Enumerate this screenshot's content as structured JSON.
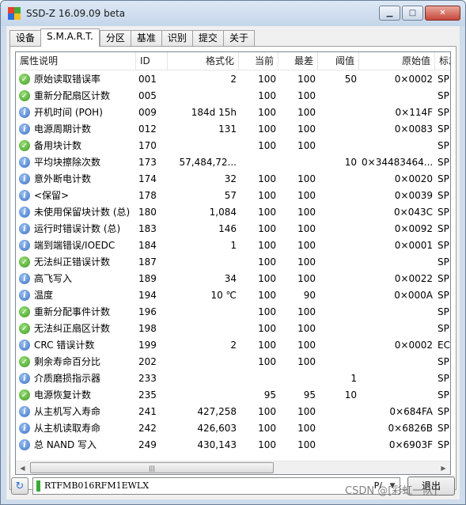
{
  "window": {
    "title": "SSD-Z 16.09.09 beta"
  },
  "tabs": [
    "设备",
    "S.M.A.R.T.",
    "分区",
    "基准",
    "识别",
    "提交",
    "关于"
  ],
  "active_tab": 1,
  "columns": [
    "属性说明",
    "ID",
    "格式化",
    "当前",
    "最差",
    "阈值",
    "原始值",
    "标志"
  ],
  "rows": [
    {
      "icon": "ok-icon",
      "name": "原始读取错误率",
      "id": "001",
      "formatted": "2",
      "current": "100",
      "worst": "100",
      "threshold": "50",
      "raw": "0×0002",
      "flags": "SP ER P"
    },
    {
      "icon": "ok-icon",
      "name": "重新分配扇区计数",
      "id": "005",
      "formatted": "",
      "current": "100",
      "worst": "100",
      "threshold": "",
      "raw": "",
      "flags": "SP EC C"
    },
    {
      "icon": "info-icon",
      "name": "开机时间 (POH)",
      "id": "009",
      "formatted": "184d 15h",
      "current": "100",
      "worst": "100",
      "threshold": "",
      "raw": "0×114F",
      "flags": "SP EC C"
    },
    {
      "icon": "info-icon",
      "name": "电源周期计数",
      "id": "012",
      "formatted": "131",
      "current": "100",
      "worst": "100",
      "threshold": "",
      "raw": "0×0083",
      "flags": "SP EC C"
    },
    {
      "icon": "ok-icon",
      "name": "备用块计数",
      "id": "170",
      "formatted": "",
      "current": "100",
      "worst": "100",
      "threshold": "",
      "raw": "",
      "flags": "SP EC C"
    },
    {
      "icon": "info-icon",
      "name": "平均块擦除次数",
      "id": "173",
      "formatted": "57,484,72...",
      "current": "",
      "worst": "",
      "threshold": "10",
      "raw": "0×34483464...",
      "flags": "SP EC C"
    },
    {
      "icon": "info-icon",
      "name": "意外断电计数",
      "id": "174",
      "formatted": "32",
      "current": "100",
      "worst": "100",
      "threshold": "",
      "raw": "0×0020",
      "flags": "SP EC C"
    },
    {
      "icon": "info-icon",
      "name": "<保留>",
      "id": "178",
      "formatted": "57",
      "current": "100",
      "worst": "100",
      "threshold": "",
      "raw": "0×0039",
      "flags": "SP EC C"
    },
    {
      "icon": "info-icon",
      "name": "未使用保留块计数 (总)",
      "id": "180",
      "formatted": "1,084",
      "current": "100",
      "worst": "100",
      "threshold": "",
      "raw": "0×043C",
      "flags": "SP EC C"
    },
    {
      "icon": "info-icon",
      "name": "运行时错误计数 (总)",
      "id": "183",
      "formatted": "146",
      "current": "100",
      "worst": "100",
      "threshold": "",
      "raw": "0×0092",
      "flags": "SP EC C"
    },
    {
      "icon": "info-icon",
      "name": "端到端错误/IOEDC",
      "id": "184",
      "formatted": "1",
      "current": "100",
      "worst": "100",
      "threshold": "",
      "raw": "0×0001",
      "flags": "SP EC C"
    },
    {
      "icon": "ok-icon",
      "name": "无法纠正错误计数",
      "id": "187",
      "formatted": "",
      "current": "100",
      "worst": "100",
      "threshold": "",
      "raw": "",
      "flags": "SP EC E"
    },
    {
      "icon": "info-icon",
      "name": "高飞写入",
      "id": "189",
      "formatted": "34",
      "current": "100",
      "worst": "100",
      "threshold": "",
      "raw": "0×0022",
      "flags": "SP ER C"
    },
    {
      "icon": "info-icon",
      "name": "温度",
      "id": "194",
      "formatted": "10 ℃",
      "current": "100",
      "worst": "90",
      "threshold": "",
      "raw": "0×000A",
      "flags": "SP EC C"
    },
    {
      "icon": "ok-icon",
      "name": "重新分配事件计数",
      "id": "196",
      "formatted": "",
      "current": "100",
      "worst": "100",
      "threshold": "",
      "raw": "",
      "flags": "SP EC C"
    },
    {
      "icon": "ok-icon",
      "name": "无法纠正扇区计数",
      "id": "198",
      "formatted": "",
      "current": "100",
      "worst": "100",
      "threshold": "",
      "raw": "",
      "flags": "SP EC C"
    },
    {
      "icon": "info-icon",
      "name": "CRC 错误计数",
      "id": "199",
      "formatted": "2",
      "current": "100",
      "worst": "100",
      "threshold": "",
      "raw": "0×0002",
      "flags": "EC OC"
    },
    {
      "icon": "ok-icon",
      "name": "剩余寿命百分比",
      "id": "202",
      "formatted": "",
      "current": "100",
      "worst": "100",
      "threshold": "",
      "raw": "",
      "flags": "SP EC C"
    },
    {
      "icon": "info-icon",
      "name": "介质磨损指示器",
      "id": "233",
      "formatted": "",
      "current": "",
      "worst": "",
      "threshold": "1",
      "raw": "",
      "flags": "SP EC C"
    },
    {
      "icon": "ok-icon",
      "name": "电源恢复计数",
      "id": "235",
      "formatted": "",
      "current": "95",
      "worst": "95",
      "threshold": "10",
      "raw": "",
      "flags": "SP EC C"
    },
    {
      "icon": "info-icon",
      "name": "从主机写入寿命",
      "id": "241",
      "formatted": "427,258",
      "current": "100",
      "worst": "100",
      "threshold": "",
      "raw": "0×684FA",
      "flags": "SP EC C"
    },
    {
      "icon": "info-icon",
      "name": "从主机读取寿命",
      "id": "242",
      "formatted": "426,603",
      "current": "100",
      "worst": "100",
      "threshold": "",
      "raw": "0×6826B",
      "flags": "SP EC C"
    },
    {
      "icon": "info-icon",
      "name": "总 NAND 写入",
      "id": "249",
      "formatted": "430,143",
      "current": "100",
      "worst": "100",
      "threshold": "",
      "raw": "0×6903F",
      "flags": "SP EC C"
    }
  ],
  "statusbar": {
    "drive": "RTFMB016RFM1EWLX",
    "drive_suffix": "P/",
    "exit_label": "退出",
    "status_color": "#3aaa35"
  },
  "watermark": "CSDN @[彩虹一队]"
}
